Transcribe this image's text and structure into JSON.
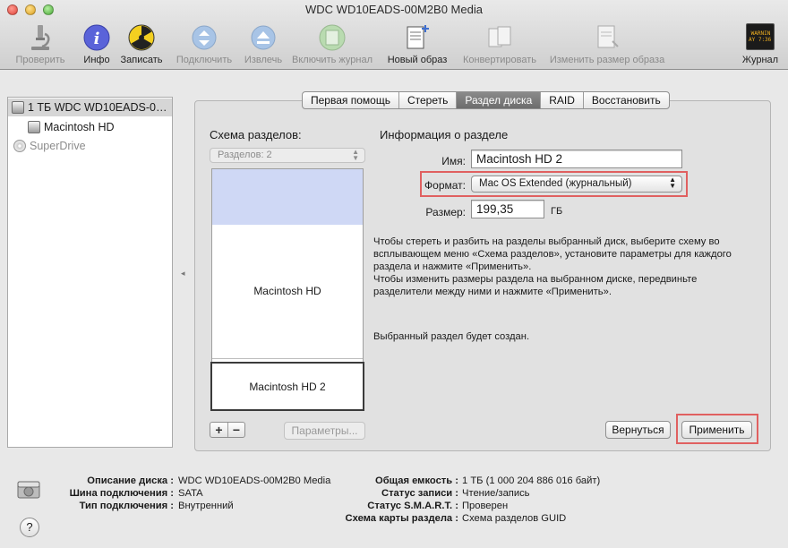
{
  "window": {
    "title": "WDC WD10EADS-00M2B0 Media"
  },
  "toolbar": {
    "verify": "Проверить",
    "info": "Инфо",
    "burn": "Записать",
    "mount": "Подключить",
    "eject": "Извлечь",
    "enable_journal": "Включить журнал",
    "new_image": "Новый образ",
    "convert": "Конвертировать",
    "resize_image": "Изменить размер образа",
    "log": "Журнал",
    "log_icon_text": "WARNIN\nAY 7:36 P"
  },
  "sidebar": {
    "items": [
      {
        "label": "1 ТБ WDC WD10EADS-0…",
        "selected": true,
        "icon": "hard-disk-icon"
      },
      {
        "label": "Macintosh HD",
        "icon": "volume-icon"
      },
      {
        "label": "SuperDrive",
        "icon": "optical-drive-icon"
      }
    ]
  },
  "tabs": [
    "Первая помощь",
    "Стереть",
    "Раздел диска",
    "RAID",
    "Восстановить"
  ],
  "active_tab": "Раздел диска",
  "scheme": {
    "heading": "Схема разделов:",
    "popup": "Разделов: 2",
    "partitions": [
      "Macintosh HD",
      "Macintosh HD 2"
    ],
    "plus": "+",
    "minus": "−",
    "options_button": "Параметры..."
  },
  "info": {
    "heading": "Информация о разделе",
    "name_label": "Имя:",
    "name_value": "Macintosh HD 2",
    "format_label": "Формат:",
    "format_value": "Mac OS Extended (журнальный)",
    "size_label": "Размер:",
    "size_value": "199,35",
    "size_unit": "ГБ",
    "description": [
      "Чтобы стереть и разбить на разделы выбранный диск, выберите схему во",
      "всплывающем меню «Схема разделов», установите параметры для каждого",
      "раздела и нажмите «Применить».",
      "Чтобы изменить размеры раздела на выбранном диске, передвиньте",
      "разделители между ними и нажмите «Применить»."
    ],
    "status": "Выбранный раздел будет создан."
  },
  "buttons": {
    "revert": "Вернуться",
    "apply": "Применить"
  },
  "footer": {
    "left_labels": [
      "Описание диска :",
      "Шина подключения :",
      "Тип подключения :"
    ],
    "left_values": [
      "WDC WD10EADS-00M2B0 Media",
      "SATA",
      "Внутренний"
    ],
    "right_labels": [
      "Общая емкость :",
      "Статус записи :",
      "Статус S.M.A.R.T. :",
      "Схема карты раздела :"
    ],
    "right_values": [
      "1 ТБ (1 000 204 886 016 байт)",
      "Чтение/запись",
      "Проверен",
      "Схема разделов GUID"
    ],
    "help": "?"
  },
  "colors": {
    "highlight_red": "#e06060",
    "free_space": "#cfd8f5"
  }
}
